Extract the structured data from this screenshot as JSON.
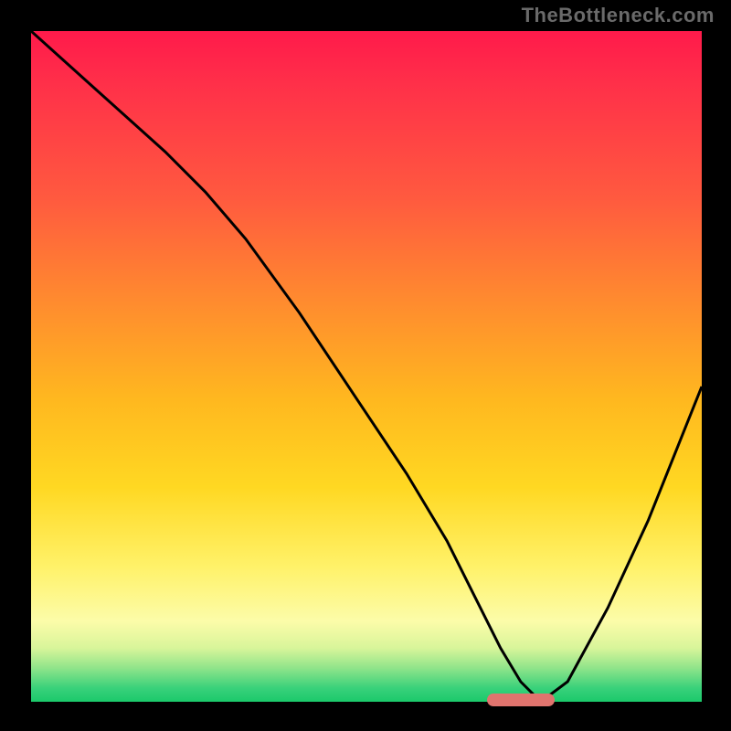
{
  "watermark": "TheBottleneck.com",
  "chart_data": {
    "type": "line",
    "title": "",
    "xlabel": "",
    "ylabel": "",
    "xlim": [
      0,
      100
    ],
    "ylim": [
      0,
      100
    ],
    "grid": false,
    "legend": false,
    "series": [
      {
        "name": "bottleneck-curve",
        "x": [
          0,
          10,
          20,
          26,
          32,
          40,
          48,
          56,
          62,
          66,
          70,
          73,
          76,
          80,
          86,
          92,
          100
        ],
        "y": [
          100,
          91,
          82,
          76,
          69,
          58,
          46,
          34,
          24,
          16,
          8,
          3,
          0,
          3,
          14,
          27,
          47
        ]
      }
    ],
    "optimal_marker": {
      "x_start": 68,
      "x_end": 78,
      "y": 0
    },
    "background_gradient": {
      "stops": [
        {
          "pos": 0,
          "color": "#ff1a4b"
        },
        {
          "pos": 25,
          "color": "#ff5a3f"
        },
        {
          "pos": 55,
          "color": "#ffb81f"
        },
        {
          "pos": 80,
          "color": "#fff26a"
        },
        {
          "pos": 95,
          "color": "#8fe48a"
        },
        {
          "pos": 100,
          "color": "#1bc96b"
        }
      ]
    }
  }
}
